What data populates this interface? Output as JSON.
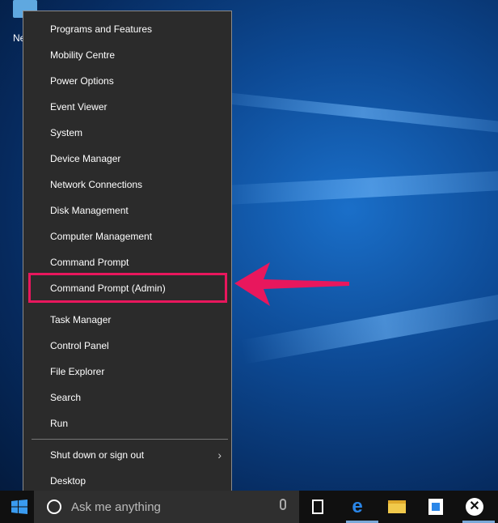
{
  "desktop": {
    "icon_label": "Ne"
  },
  "menu": {
    "items": [
      "Programs and Features",
      "Mobility Centre",
      "Power Options",
      "Event Viewer",
      "System",
      "Device Manager",
      "Network Connections",
      "Disk Management",
      "Computer Management",
      "Command Prompt",
      "Command Prompt (Admin)",
      "Task Manager",
      "Control Panel",
      "File Explorer",
      "Search",
      "Run"
    ],
    "bottom": [
      "Shut down or sign out",
      "Desktop"
    ],
    "submenu_chevron": "›",
    "highlighted": "Command Prompt (Admin)"
  },
  "annotation": {
    "color": "#e8175d"
  },
  "taskbar": {
    "search_placeholder": "Ask me anything",
    "start_icon": "windows-logo-icon",
    "apps": [
      "task-view-icon",
      "edge-icon",
      "file-explorer-icon",
      "store-icon",
      "xbox-icon"
    ]
  }
}
